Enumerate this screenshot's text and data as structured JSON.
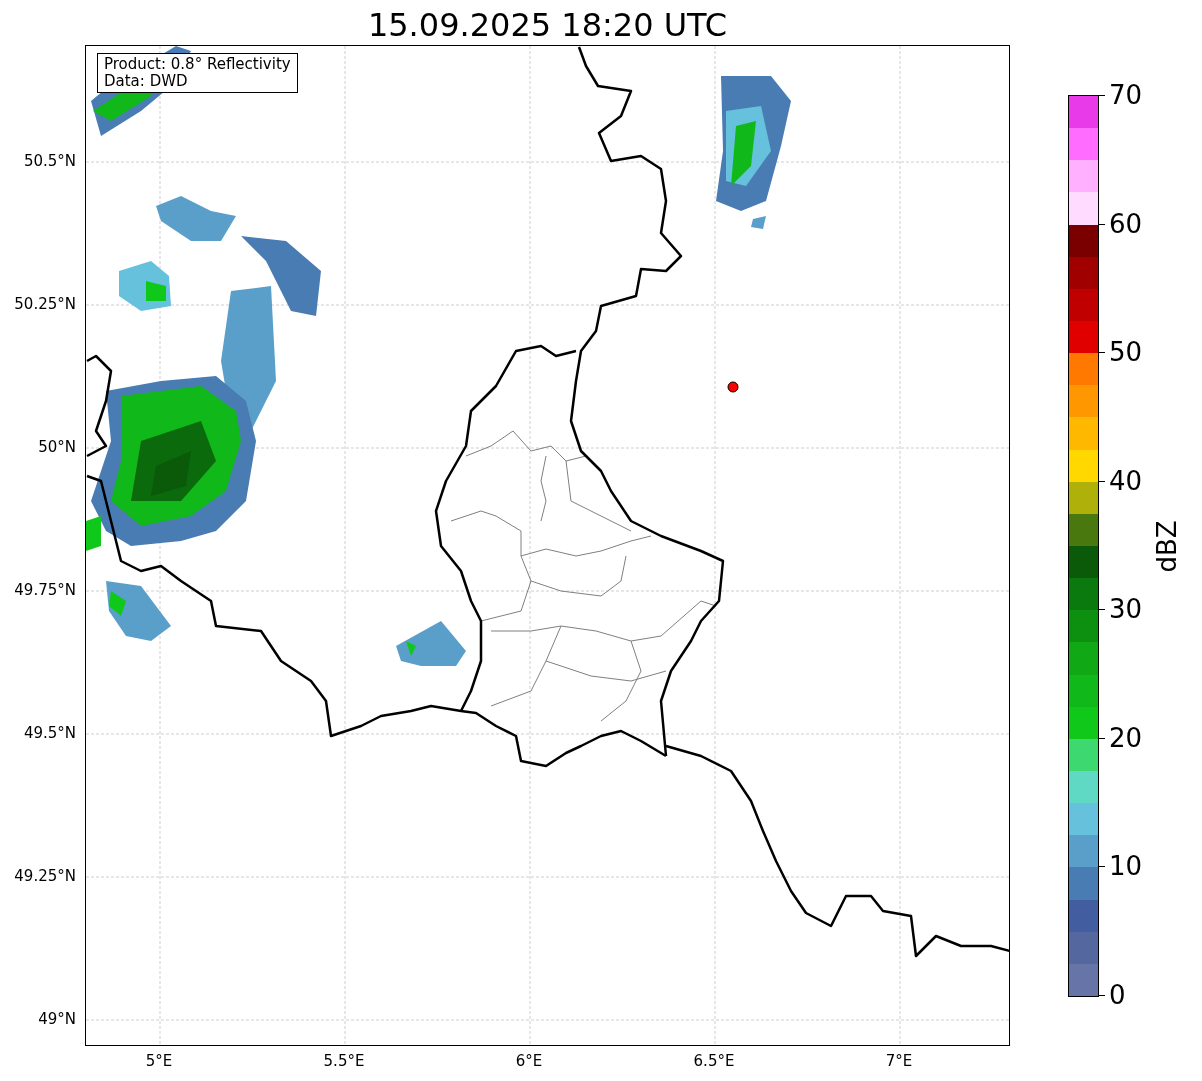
{
  "title": "15.09.2025 18:20 UTC",
  "annotation": [
    "Product: 0.8° Reflectivity",
    "Data: DWD"
  ],
  "y_ticks": [
    "50.5°N",
    "50.25°N",
    "50°N",
    "49.75°N",
    "49.5°N",
    "49.25°N",
    "49°N"
  ],
  "x_ticks": [
    "5°E",
    "5.5°E",
    "6°E",
    "6.5°E",
    "7°E"
  ],
  "colorbar": {
    "label": "dBZ",
    "ticks": [
      "70",
      "60",
      "50",
      "40",
      "30",
      "20",
      "10",
      "0"
    ],
    "segments": [
      {
        "color": "#e83ae8"
      },
      {
        "color": "#ff6cff"
      },
      {
        "color": "#ffb0ff"
      },
      {
        "color": "#ffdcff"
      },
      {
        "color": "#7a0000"
      },
      {
        "color": "#a00000"
      },
      {
        "color": "#c00000"
      },
      {
        "color": "#e00000"
      },
      {
        "color": "#ff7800"
      },
      {
        "color": "#ff9800"
      },
      {
        "color": "#ffb800"
      },
      {
        "color": "#ffd800"
      },
      {
        "color": "#b0b00a"
      },
      {
        "color": "#48780e"
      },
      {
        "color": "#0a5a0a"
      },
      {
        "color": "#0b7a0e"
      },
      {
        "color": "#0d9010"
      },
      {
        "color": "#10a814"
      },
      {
        "color": "#10b81a"
      },
      {
        "color": "#10c81a"
      },
      {
        "color": "#3dd870"
      },
      {
        "color": "#5fd8c4"
      },
      {
        "color": "#66c1dc"
      },
      {
        "color": "#5a9fca"
      },
      {
        "color": "#4a7cb4"
      },
      {
        "color": "#435ea0"
      },
      {
        "color": "#54689f"
      },
      {
        "color": "#6674a8"
      }
    ]
  }
}
